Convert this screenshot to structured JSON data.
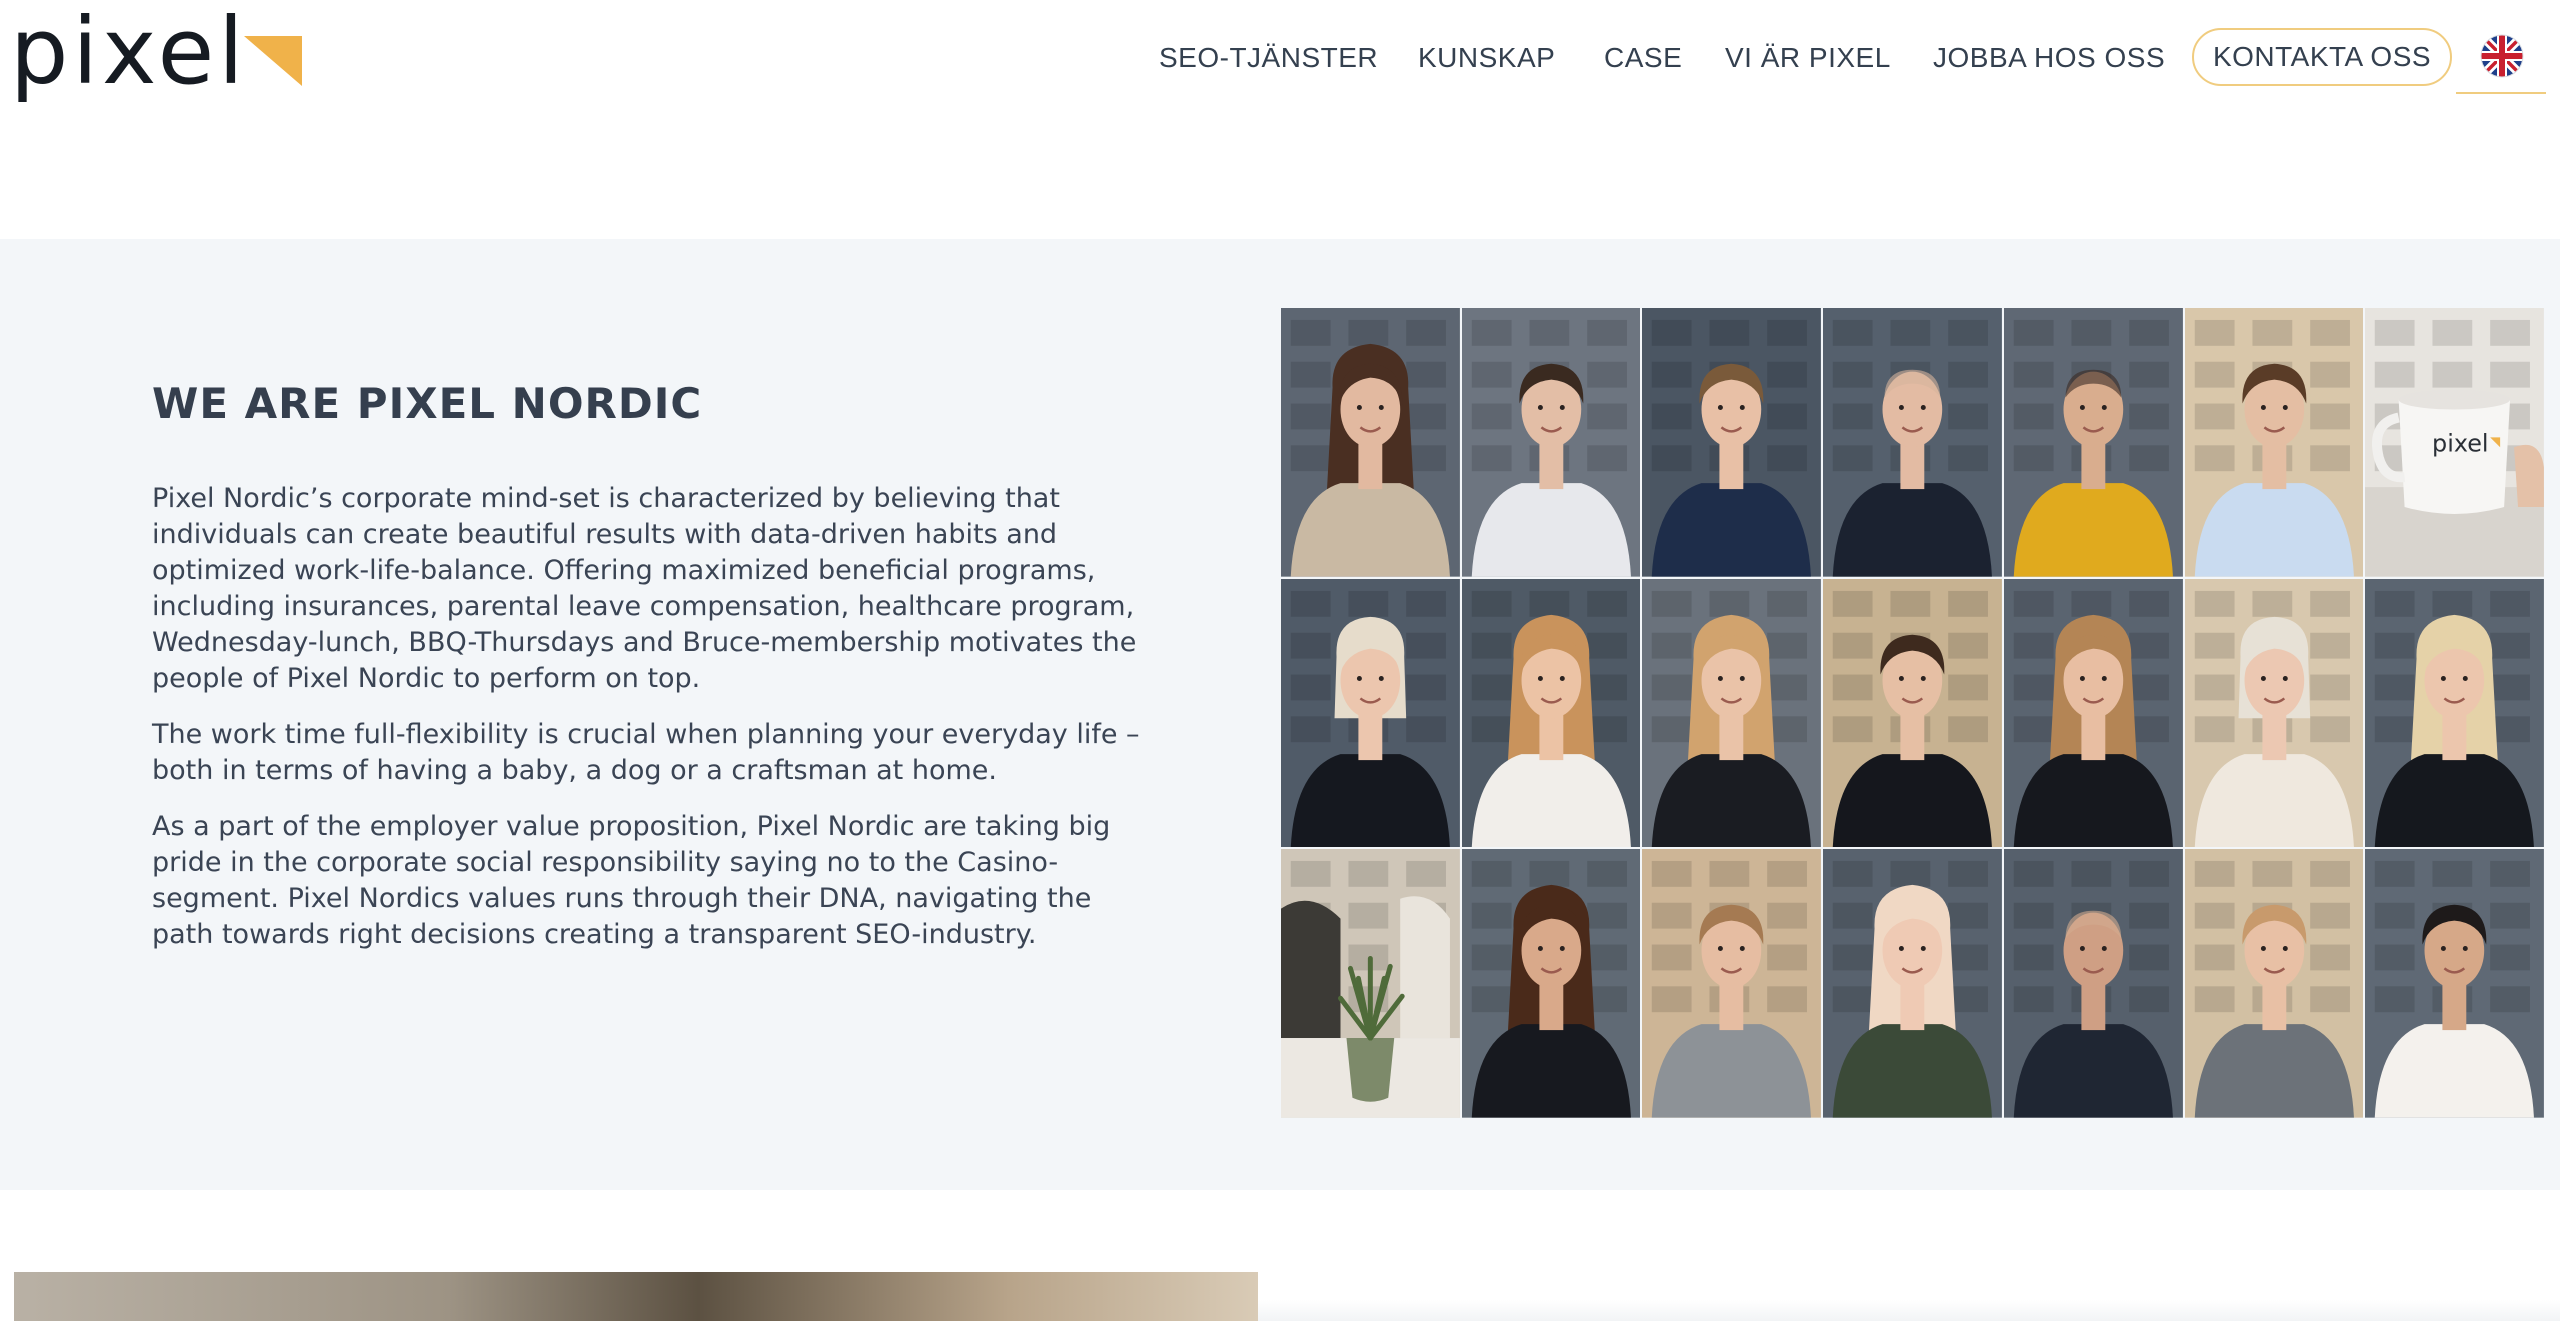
{
  "brand": {
    "logo_text": "pixel",
    "accent_color": "#f0b24a"
  },
  "nav": {
    "items": [
      {
        "label": "SEO-TJÄNSTER"
      },
      {
        "label": "KUNSKAP"
      },
      {
        "label": "CASE"
      },
      {
        "label": "VI ÄR PIXEL"
      },
      {
        "label": "JOBBA HOS OSS"
      }
    ],
    "contact_label": "KONTAKTA OSS",
    "language_icon": "uk-flag-icon"
  },
  "about": {
    "title": "WE ARE PIXEL NORDIC",
    "paragraphs": [
      "Pixel Nordic’s corporate mind-set is characterized by believing that individuals can create beautiful results with data-driven habits and optimized work-life-balance. Offering maximized beneficial programs, including insurances, parental leave compensation, healthcare program, Wednesday-lunch, BBQ-Thursdays and Bruce-membership motivates the people of Pixel Nordic to perform on top.",
      "The work time full-flexibility is crucial when planning your everyday life – both in terms of having a baby, a dog or a craftsman at home.",
      "As a part of the employer value proposition, Pixel Nordic are taking big pride in the corporate social responsibility saying no to the Casino-segment. Pixel Nordics values runs through their DNA, navigating the path towards right decisions creating a transparent SEO-industry."
    ],
    "background_color": "#f3f6f9"
  },
  "team_photos": [
    {
      "kind": "portrait",
      "bg": "#5d6672",
      "hair": "#4a2f22",
      "hair_style": "long",
      "top": "#c9b9a3",
      "skin": "#e2b9a0"
    },
    {
      "kind": "portrait",
      "bg": "#6d7580",
      "hair": "#3a2a20",
      "hair_style": "short",
      "top": "#e7e8ec",
      "skin": "#e3bea6"
    },
    {
      "kind": "portrait",
      "bg": "#4b5663",
      "hair": "#7a5a3a",
      "hair_style": "short",
      "top": "#1e2d4a",
      "skin": "#e8c0a6"
    },
    {
      "kind": "portrait",
      "bg": "#55606d",
      "hair": "#d6b49c",
      "hair_style": "bald",
      "top": "#1b2230",
      "skin": "#e3bba3"
    },
    {
      "kind": "portrait",
      "bg": "#5f6874",
      "hair": "#3b2c24",
      "hair_style": "bald",
      "top": "#e0aa1e",
      "skin": "#d9ad8e"
    },
    {
      "kind": "portrait",
      "bg": "#d9c7aa",
      "hair": "#5a3c27",
      "hair_style": "short",
      "top": "#c9dbf0",
      "skin": "#e4bea3"
    },
    {
      "kind": "mug",
      "bg": "#e7e4df",
      "mug_text": "pixel"
    },
    {
      "kind": "portrait",
      "bg": "#505b68",
      "hair": "#e6dccb",
      "hair_style": "bob",
      "top": "#15181f",
      "skin": "#ecc6ae"
    },
    {
      "kind": "portrait",
      "bg": "#4f5a66",
      "hair": "#c9935c",
      "hair_style": "long",
      "top": "#f1eeea",
      "skin": "#ecc3a5"
    },
    {
      "kind": "portrait",
      "bg": "#6a727c",
      "hair": "#d1a36e",
      "hair_style": "long",
      "top": "#1a1c22",
      "skin": "#eac3a8"
    },
    {
      "kind": "portrait",
      "bg": "#c7b291",
      "hair": "#3e2a1e",
      "hair_style": "short",
      "top": "#15171d",
      "skin": "#e6bfa4"
    },
    {
      "kind": "portrait",
      "bg": "#5a6470",
      "hair": "#b48555",
      "hair_style": "long",
      "top": "#16181e",
      "skin": "#e8bea2"
    },
    {
      "kind": "portrait",
      "bg": "#d8c8ae",
      "hair": "#e7e1d6",
      "hair_style": "bob",
      "top": "#efe8de",
      "skin": "#ecc8b2"
    },
    {
      "kind": "portrait",
      "bg": "#5b6571",
      "hair": "#e5d2a8",
      "hair_style": "long",
      "top": "#15181e",
      "skin": "#ecc6ad"
    },
    {
      "kind": "plant",
      "bg": "#cfc6b8"
    },
    {
      "kind": "portrait",
      "bg": "#606a75",
      "hair": "#4a2a1a",
      "hair_style": "curly",
      "top": "#17191f",
      "skin": "#d9a98a"
    },
    {
      "kind": "portrait",
      "bg": "#cdb596",
      "hair": "#a57a52",
      "hair_style": "short",
      "top": "#8d9297",
      "skin": "#e6bda2"
    },
    {
      "kind": "portrait",
      "bg": "#58626e",
      "hair": "#f0d8c4",
      "hair_style": "long",
      "top": "#3b4a38",
      "skin": "#efcab4"
    },
    {
      "kind": "portrait",
      "bg": "#56606c",
      "hair": "#d2ab8f",
      "hair_style": "bald",
      "top": "#1f2633",
      "skin": "#cf9f84"
    },
    {
      "kind": "portrait",
      "bg": "#d2c0a3",
      "hair": "#c89a6c",
      "hair_style": "short",
      "top": "#6c7279",
      "skin": "#e8c0a5"
    },
    {
      "kind": "portrait",
      "bg": "#5f6975",
      "hair": "#1e1a1a",
      "hair_style": "short",
      "top": "#f4f1ed",
      "skin": "#d6a888"
    }
  ]
}
